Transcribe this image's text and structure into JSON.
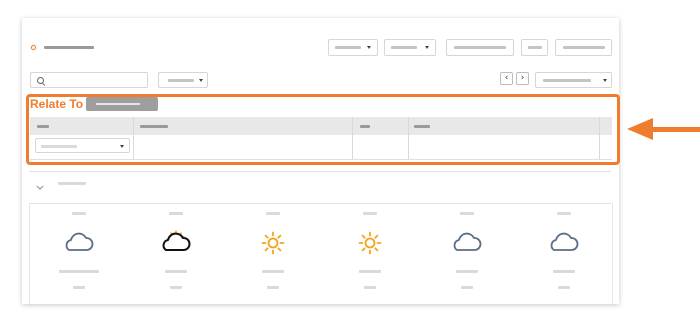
{
  "relate": {
    "label": "Relate To"
  },
  "navigation": {
    "prev_icon": "chevron-left-icon",
    "next_icon": "chevron-right-icon",
    "prev_glyph": "‹",
    "next_glyph": "›"
  },
  "weather": {
    "days": [
      {
        "icon": "cloud-icon",
        "color": "#5b6f86"
      },
      {
        "icon": "partly-sunny-cloud-icon",
        "color": "#111111",
        "accent": "#f2a51c"
      },
      {
        "icon": "sun-icon",
        "color": "#f2a51c"
      },
      {
        "icon": "sun-icon",
        "color": "#f2a51c"
      },
      {
        "icon": "cloud-icon",
        "color": "#5b6f86"
      },
      {
        "icon": "cloud-icon",
        "color": "#5b6f86"
      }
    ]
  },
  "colors": {
    "accent": "#ee7d2d",
    "badge": "#9e9e9e"
  }
}
